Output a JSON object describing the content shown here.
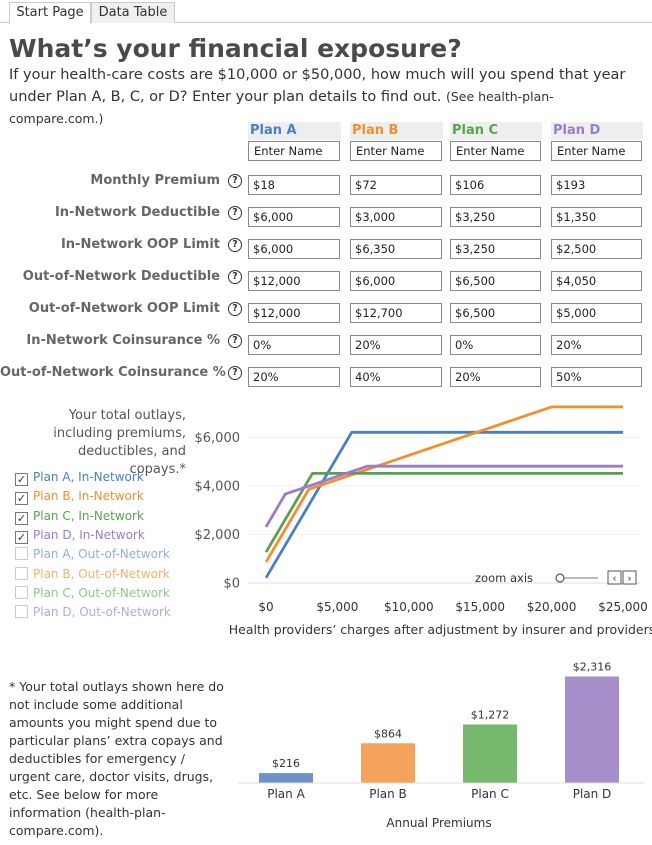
{
  "tabs": [
    "Start Page",
    "Data Table"
  ],
  "title": "What’s your financial exposure?",
  "intro": {
    "text": "If your health-care costs are $10,000 or $50,000, how much will you spend that year under Plan A, B, C, or D? Enter your plan details to find out.",
    "source": "(See health-plan-compare.com.)"
  },
  "colors": {
    "plan_a": "#4a7fc1",
    "plan_b": "#f28e2b",
    "plan_c": "#59a14f",
    "plan_d": "#9d7bc9"
  },
  "plans": [
    {
      "label": "Plan A",
      "name_placeholder": "Enter Name",
      "color": "#4a7fc1"
    },
    {
      "label": "Plan B",
      "name_placeholder": "Enter Name",
      "color": "#f28e2b"
    },
    {
      "label": "Plan C",
      "name_placeholder": "Enter Name",
      "color": "#59a14f"
    },
    {
      "label": "Plan D",
      "name_placeholder": "Enter Name",
      "color": "#9d7bc9"
    }
  ],
  "rows": [
    {
      "label": "Monthly Premium",
      "values": [
        "$18",
        "$72",
        "$106",
        "$193"
      ]
    },
    {
      "label": "In-Network Deductible",
      "values": [
        "$6,000",
        "$3,000",
        "$3,250",
        "$1,350"
      ]
    },
    {
      "label": "In-Network OOP Limit",
      "values": [
        "$6,000",
        "$6,350",
        "$3,250",
        "$2,500"
      ]
    },
    {
      "label": "Out-of-Network Deductible",
      "values": [
        "$12,000",
        "$6,000",
        "$6,500",
        "$4,050"
      ]
    },
    {
      "label": "Out-of-Network OOP Limit",
      "values": [
        "$12,000",
        "$12,700",
        "$6,500",
        "$5,000"
      ]
    },
    {
      "label": "In-Network Coinsurance %",
      "values": [
        "0%",
        "20%",
        "0%",
        "20%"
      ]
    },
    {
      "label": "Out-of-Network Coinsurance %",
      "values": [
        "20%",
        "40%",
        "20%",
        "50%"
      ]
    }
  ],
  "help_icon": "question-circle-icon",
  "outlays_note": "Your total outlays, including premiums, deductibles, and copays.*",
  "legend": [
    {
      "label": "Plan A, In-Network",
      "checked": true,
      "color": "#4a7fc1"
    },
    {
      "label": "Plan B, In-Network",
      "checked": true,
      "color": "#f28e2b"
    },
    {
      "label": "Plan C, In-Network",
      "checked": true,
      "color": "#59a14f"
    },
    {
      "label": "Plan D, In-Network",
      "checked": true,
      "color": "#9d7bc9"
    },
    {
      "label": "Plan A, Out-of-Network",
      "checked": false,
      "color": "#8fb0dc"
    },
    {
      "label": "Plan B, Out-of-Network",
      "checked": false,
      "color": "#f6b06a"
    },
    {
      "label": "Plan C, Out-of-Network",
      "checked": false,
      "color": "#8fc784"
    },
    {
      "label": "Plan D, Out-of-Network",
      "checked": false,
      "color": "#bba5de"
    }
  ],
  "zoom_label": "zoom axis",
  "footnote": "* Your total outlays shown here do not include some additional amounts you might spend due to particular plans’ extra copays and deductibles for emergency / urgent care, doctor visits, drugs, etc. See below for more information (health-plan-compare.com).",
  "chart_data": [
    {
      "type": "line",
      "xlabel": "Health providers’ charges after adjustment by insurer and providers.",
      "ylabel": "",
      "xlim": [
        0,
        25000
      ],
      "ylim": [
        0,
        7000
      ],
      "x_ticks": [
        "$0",
        "$5,000",
        "$10,000",
        "$15,000",
        "$20,000",
        "$25,000"
      ],
      "y_ticks": [
        "$0",
        "$2,000",
        "$4,000",
        "$6,000"
      ],
      "series": [
        {
          "name": "Plan A, In-Network",
          "color": "#4a7fc1",
          "points": [
            [
              0,
              216
            ],
            [
              6000,
              6216
            ],
            [
              25000,
              6216
            ]
          ]
        },
        {
          "name": "Plan B, In-Network",
          "color": "#f28e2b",
          "points": [
            [
              0,
              864
            ],
            [
              3000,
              3864
            ],
            [
              20000,
              7264
            ],
            [
              25000,
              7264
            ]
          ]
        },
        {
          "name": "Plan C, In-Network",
          "color": "#59a14f",
          "points": [
            [
              0,
              1272
            ],
            [
              3250,
              4522
            ],
            [
              25000,
              4522
            ]
          ]
        },
        {
          "name": "Plan D, In-Network",
          "color": "#9d7bc9",
          "points": [
            [
              0,
              2316
            ],
            [
              1350,
              3666
            ],
            [
              7100,
              4816
            ],
            [
              25000,
              4816
            ]
          ]
        }
      ]
    },
    {
      "type": "bar",
      "title": "",
      "xlabel": "Annual Premiums",
      "categories": [
        "Plan A",
        "Plan B",
        "Plan C",
        "Plan D"
      ],
      "values": [
        216,
        864,
        1272,
        2316
      ],
      "value_labels": [
        "$216",
        "$864",
        "$1,272",
        "$2,316"
      ],
      "colors": [
        "#6f93c8",
        "#f4a25c",
        "#76b86c",
        "#a68ec9"
      ],
      "ylim": [
        0,
        2500
      ]
    }
  ]
}
